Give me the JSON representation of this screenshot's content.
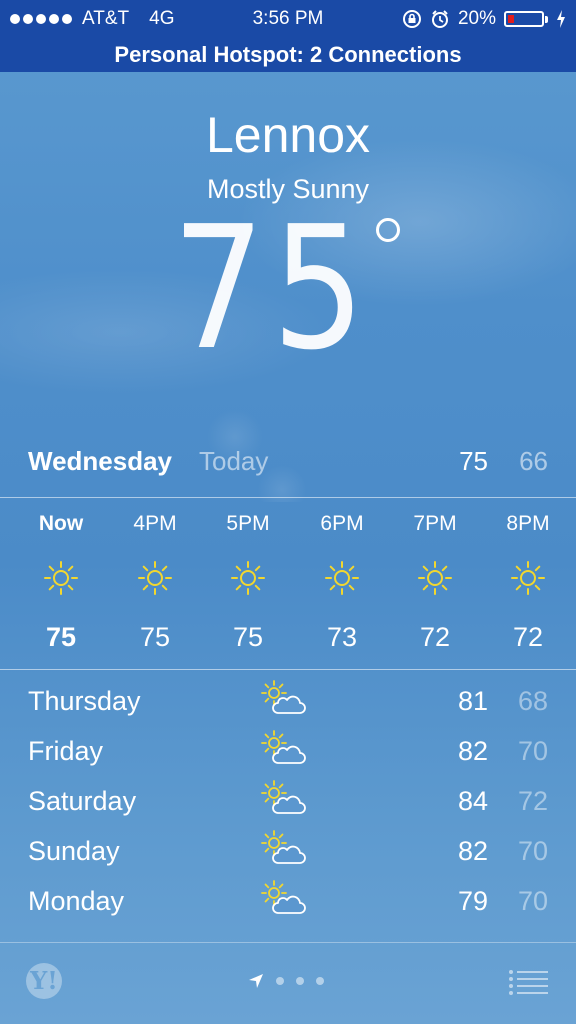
{
  "status_bar": {
    "carrier": "AT&T",
    "network": "4G",
    "time": "3:56 PM",
    "battery_percent": "20%",
    "battery_level": 0.2,
    "icons": [
      "signal-dots-icon",
      "orientation-lock-icon",
      "alarm-icon",
      "battery-icon",
      "charging-bolt-icon"
    ]
  },
  "hotspot": {
    "text": "Personal Hotspot: 2 Connections"
  },
  "current": {
    "city": "Lennox",
    "condition": "Mostly Sunny",
    "temperature": "75"
  },
  "today": {
    "day": "Wednesday",
    "label": "Today",
    "high": "75",
    "low": "66"
  },
  "hourly": [
    {
      "time": "Now",
      "temp": "75",
      "icon": "sun-icon"
    },
    {
      "time": "4PM",
      "temp": "75",
      "icon": "sun-icon"
    },
    {
      "time": "5PM",
      "temp": "75",
      "icon": "sun-icon"
    },
    {
      "time": "6PM",
      "temp": "73",
      "icon": "sun-icon"
    },
    {
      "time": "7PM",
      "temp": "72",
      "icon": "sun-icon"
    },
    {
      "time": "8PM",
      "temp": "72",
      "icon": "sun-icon"
    }
  ],
  "daily": [
    {
      "day": "Thursday",
      "high": "81",
      "low": "68",
      "icon": "partly-cloudy-icon"
    },
    {
      "day": "Friday",
      "high": "82",
      "low": "70",
      "icon": "partly-cloudy-icon"
    },
    {
      "day": "Saturday",
      "high": "84",
      "low": "72",
      "icon": "partly-cloudy-icon"
    },
    {
      "day": "Sunday",
      "high": "82",
      "low": "70",
      "icon": "partly-cloudy-icon"
    },
    {
      "day": "Monday",
      "high": "79",
      "low": "70",
      "icon": "partly-cloudy-icon"
    }
  ],
  "footer": {
    "logo": "Y!",
    "icons": [
      "yahoo-logo-icon",
      "location-arrow-icon",
      "page-dot-icon",
      "list-icon"
    ]
  },
  "colors": {
    "status_bar_bg": "#1a4aa6",
    "sun": "#f2d72f",
    "battery_low": "#e11c1c"
  }
}
